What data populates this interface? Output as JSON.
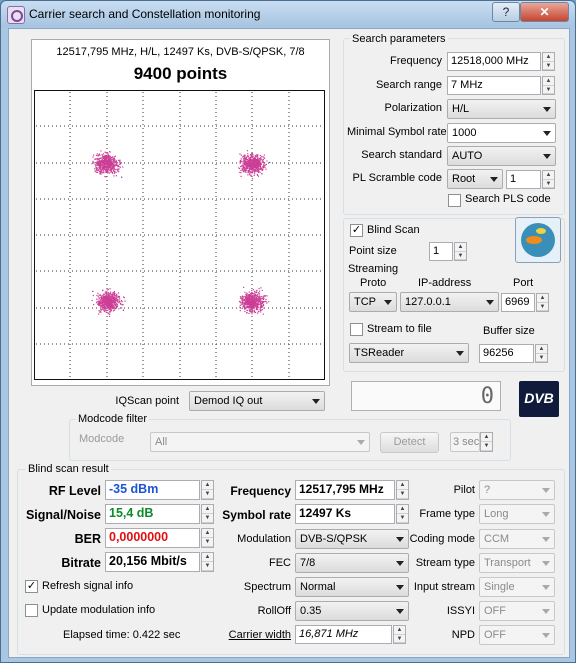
{
  "window": {
    "title": "Carrier search and Constellation monitoring",
    "help": "?",
    "close": "✕"
  },
  "constellation": {
    "info": "12517,795 MHz, H/L, 12497 Ks, DVB-S/QPSK, 7/8",
    "points_label": "9400 points"
  },
  "search_params": {
    "title": "Search parameters",
    "frequency_label": "Frequency",
    "frequency_value": "12518,000 MHz",
    "search_range_label": "Search range",
    "search_range_value": "7 MHz",
    "polarization_label": "Polarization",
    "polarization_value": "H/L",
    "min_symbol_label": "Minimal Symbol rate",
    "min_symbol_value": "1000",
    "standard_label": "Search standard",
    "standard_value": "AUTO",
    "pl_label": "PL Scramble code",
    "pl_mode": "Root",
    "pl_value": "1",
    "pls_search_label": "Search PLS code"
  },
  "blind_scan": {
    "label": "Blind Scan",
    "checked": true,
    "point_size_label": "Point size",
    "point_size_value": "1"
  },
  "streaming": {
    "title": "Streaming",
    "proto_label": "Proto",
    "ip_label": "IP-address",
    "port_label": "Port",
    "proto_value": "TCP",
    "ip_value": "127.0.0.1",
    "port_value": "6969",
    "stream_to_file_label": "Stream to file",
    "buffer_label": "Buffer size",
    "app_value": "TSReader",
    "buffer_value": "96256"
  },
  "lcd_value": "0",
  "dvb_logo": "DVB",
  "iqscan": {
    "label": "IQScan point",
    "value": "Demod IQ out"
  },
  "modcode": {
    "title": "Modcode filter",
    "label": "Modcode",
    "value": "All",
    "detect": "Detect",
    "interval": "3 sec"
  },
  "result": {
    "title": "Blind scan result",
    "rf_level_label": "RF Level",
    "rf_level_value": "-35 dBm",
    "snr_label": "Signal/Noise",
    "snr_value": "15,4 dB",
    "ber_label": "BER",
    "ber_value": "0,0000000",
    "bitrate_label": "Bitrate",
    "bitrate_value": "20,156 Mbit/s",
    "refresh_label": "Refresh signal info",
    "update_label": "Update modulation info",
    "elapsed": "Elapsed time: 0.422 sec",
    "frequency_label": "Frequency",
    "frequency_value": "12517,795 MHz",
    "symrate_label": "Symbol rate",
    "symrate_value": "12497 Ks",
    "modulation_label": "Modulation",
    "modulation_value": "DVB-S/QPSK",
    "fec_label": "FEC",
    "fec_value": "7/8",
    "spectrum_label": "Spectrum",
    "spectrum_value": "Normal",
    "rolloff_label": "RollOff",
    "rolloff_value": "0.35",
    "carrier_width_label": "Carrier width",
    "carrier_width_value": "16,871 MHz",
    "pilot_label": "Pilot",
    "pilot_value": "?",
    "frame_label": "Frame type",
    "frame_value": "Long",
    "coding_label": "Coding mode",
    "coding_value": "CCM",
    "stream_type_label": "Stream type",
    "stream_type_value": "Transport",
    "input_stream_label": "Input stream",
    "input_stream_value": "Single",
    "issyi_label": "ISSYI",
    "issyi_value": "OFF",
    "npd_label": "NPD",
    "npd_value": "OFF"
  },
  "colors": {
    "rf": "#1a55d6",
    "snr": "#0e8a2a",
    "ber": "#e01010",
    "cluster": "#cc3f96",
    "cluster_edge": "#3a3ad0"
  }
}
